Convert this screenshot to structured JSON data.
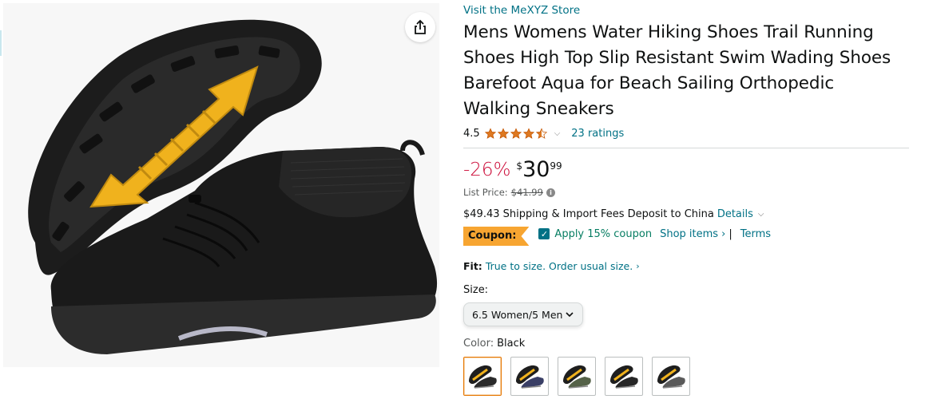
{
  "product": {
    "store_link": "Visit the MeXYZ Store",
    "title_lines": [
      "Mens Womens Water Hiking Shoes Trail Running",
      "Shoes High Top Slip Resistant Swim Wading Shoes",
      "Barefoot Aqua for Beach Sailing Orthopedic",
      "Walking Sneakers"
    ]
  },
  "rating": {
    "value": "4.5",
    "stars": 4.5,
    "count_link": "23 ratings",
    "star_color": "#de7921"
  },
  "price": {
    "discount": "-26%",
    "symbol": "$",
    "whole": "30",
    "fraction": "99",
    "list_price_label": "List Price:",
    "list_price_value": "$41.99"
  },
  "shipping": {
    "text": "$49.43 Shipping & Import Fees Deposit to China",
    "details_link": "Details"
  },
  "coupon": {
    "badge": "Coupon:",
    "apply_text": "Apply 15% coupon",
    "shop_items": "Shop items ›",
    "pipe": "|",
    "terms": "Terms",
    "badge_color": "#f7a531"
  },
  "fit": {
    "label": "Fit:",
    "text": "True to size. Order usual size.",
    "chevron": "›"
  },
  "size": {
    "label": "Size:",
    "selected": "6.5 Women/5 Men"
  },
  "color": {
    "label": "Color:",
    "selected": "Black",
    "swatches": [
      {
        "name": "Black",
        "color": "#2a2a2a",
        "selected": true
      },
      {
        "name": "Navy",
        "color": "#3a3f66",
        "selected": false
      },
      {
        "name": "Green",
        "color": "#556248",
        "selected": false
      },
      {
        "name": "Black/Red",
        "color": "#262626",
        "selected": false
      },
      {
        "name": "Grey",
        "color": "#5a5a5a",
        "selected": false
      }
    ]
  },
  "colors": {
    "link": "#007185",
    "discount": "#cc0c39",
    "coupon_check": "#067d62",
    "selected_border": "#e77600"
  }
}
